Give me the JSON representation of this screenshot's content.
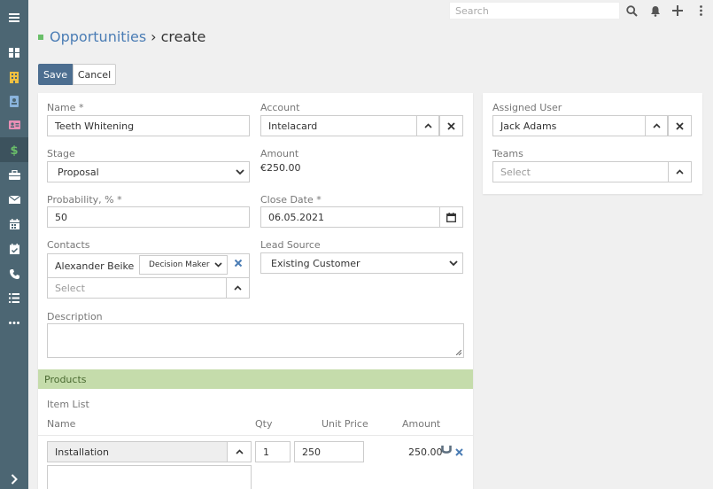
{
  "sidebar": {
    "items": [
      {
        "icon": "menu-icon"
      },
      {
        "icon": "dashboard-icon"
      },
      {
        "icon": "building-icon"
      },
      {
        "icon": "contact-icon"
      },
      {
        "icon": "id-card-icon"
      },
      {
        "icon": "dollar-icon"
      },
      {
        "icon": "briefcase-icon"
      },
      {
        "icon": "envelope-icon"
      },
      {
        "icon": "calendar-icon"
      },
      {
        "icon": "calendar-check-icon"
      },
      {
        "icon": "phone-icon"
      },
      {
        "icon": "task-list-icon"
      },
      {
        "icon": "more-icon"
      },
      {
        "icon": "expand-icon"
      }
    ],
    "active_icon": "dollar-icon",
    "colors": {
      "bg": "#4c6673",
      "active": "#3c525d",
      "icon_active": "#6abf69",
      "icon": "#ffffff"
    }
  },
  "topbar": {
    "search_placeholder": "Search"
  },
  "header": {
    "module": "Opportunities",
    "separator": "›",
    "current": "create"
  },
  "buttons": {
    "save": "Save",
    "cancel": "Cancel"
  },
  "form": {
    "name": {
      "label": "Name *",
      "value": "Teeth Whitening"
    },
    "account": {
      "label": "Account",
      "value": "Intelacard"
    },
    "stage": {
      "label": "Stage",
      "value": "Proposal"
    },
    "amount": {
      "label": "Amount",
      "value": "€250.00"
    },
    "probability": {
      "label": "Probability, % *",
      "value": "50"
    },
    "close_date": {
      "label": "Close Date *",
      "value": "06.05.2021"
    },
    "contacts": {
      "label": "Contacts",
      "items": [
        {
          "name": "Alexander Beike",
          "role": "Decision Maker"
        }
      ],
      "select_placeholder": "Select"
    },
    "lead_source": {
      "label": "Lead Source",
      "value": "Existing Customer"
    },
    "description": {
      "label": "Description",
      "value": ""
    }
  },
  "side": {
    "assigned_user": {
      "label": "Assigned User",
      "value": "Jack Adams"
    },
    "teams": {
      "label": "Teams",
      "placeholder": "Select"
    }
  },
  "products": {
    "title": "Products",
    "item_list_label": "Item List",
    "columns": {
      "name": "Name",
      "qty": "Qty",
      "unit_price": "Unit Price",
      "amount": "Amount"
    },
    "rows": [
      {
        "name": "Installation",
        "qty": "1",
        "unit_price": "250",
        "amount": "250.00"
      }
    ]
  }
}
